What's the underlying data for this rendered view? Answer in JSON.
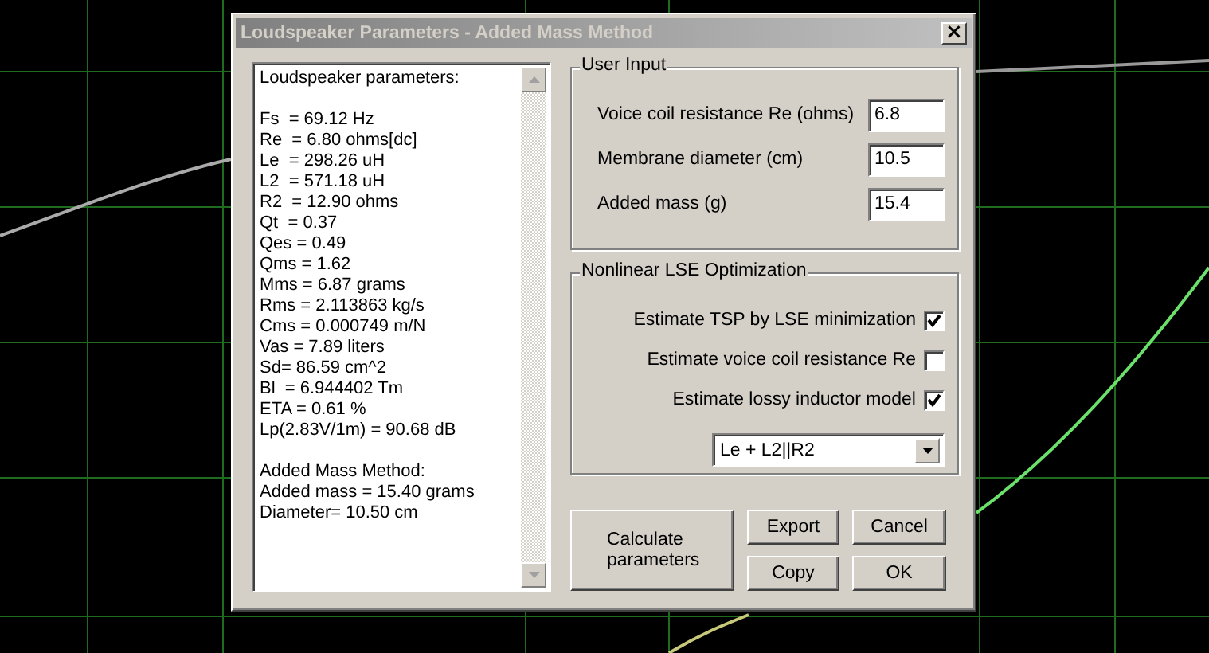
{
  "window": {
    "title": "Loudspeaker Parameters - Added Mass Method",
    "close": "×"
  },
  "results": {
    "blocks": [
      [
        "Loudspeaker parameters:"
      ],
      [
        "Fs  = 69.12 Hz",
        "Re  = 6.80 ohms[dc]",
        "Le  = 298.26 uH",
        "L2  = 571.18 uH",
        "R2  = 12.90 ohms",
        "Qt  = 0.37",
        "Qes = 0.49",
        "Qms = 1.62",
        "Mms = 6.87 grams",
        "Rms = 2.113863 kg/s",
        "Cms = 0.000749 m/N",
        "Vas = 7.89 liters",
        "Sd= 86.59 cm^2",
        "Bl  = 6.944402 Tm",
        "ETA = 0.61 %",
        "Lp(2.83V/1m) = 90.68 dB"
      ],
      [
        "Added Mass Method:",
        "Added mass = 15.40 grams",
        "Diameter= 10.50 cm"
      ]
    ]
  },
  "user_input": {
    "title": "User Input",
    "fields": [
      {
        "label": "Voice coil resistance Re (ohms)",
        "value": "6.8"
      },
      {
        "label": "Membrane diameter (cm)",
        "value": "10.5"
      },
      {
        "label": "Added mass (g)",
        "value": "15.4"
      }
    ]
  },
  "optimization": {
    "title": "Nonlinear LSE Optimization",
    "options": [
      {
        "label": "Estimate TSP by LSE minimization",
        "checked": true
      },
      {
        "label": "Estimate voice coil resistance Re",
        "checked": false
      },
      {
        "label": "Estimate lossy inductor model",
        "checked": true
      }
    ],
    "model": "Le + L2||R2"
  },
  "buttons": [
    {
      "label": "Calculate parameters",
      "kind": "large"
    },
    {
      "label": "Export",
      "kind": "small"
    },
    {
      "label": "Cancel",
      "kind": "small"
    },
    {
      "label": "Copy",
      "kind": "small"
    },
    {
      "label": "OK",
      "kind": "small"
    }
  ]
}
